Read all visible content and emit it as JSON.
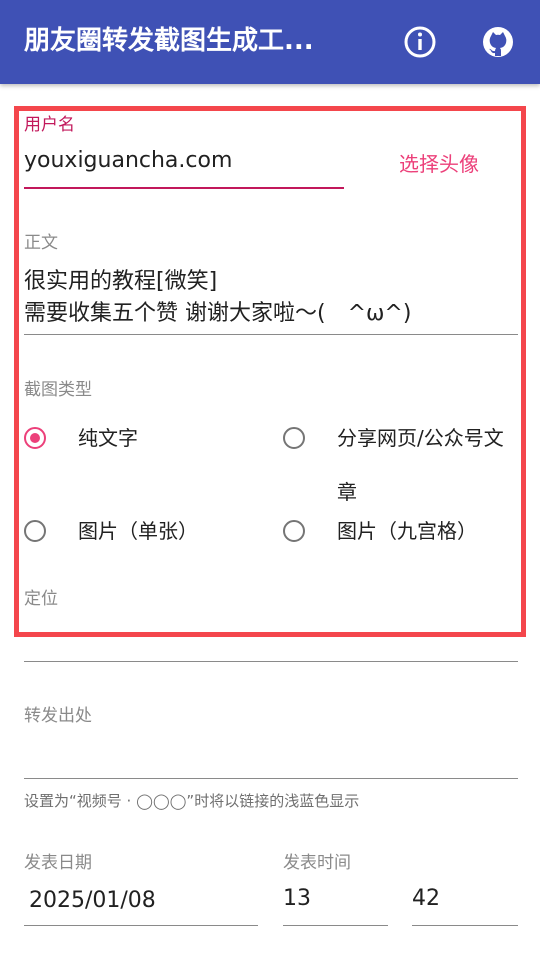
{
  "appbar": {
    "title": "朋友圈转发截图生成工...",
    "info_icon": "info-icon",
    "github_icon": "github-icon"
  },
  "username": {
    "label": "用户名",
    "value": "youxiguancha.com",
    "avatar_button": "选择头像"
  },
  "body_text": {
    "label": "正文",
    "line1": "很实用的教程[微笑]",
    "line2": "需要收集五个赞 谢谢大家啦～(　^ω^)"
  },
  "screenshot_type": {
    "label": "截图类型",
    "options": [
      {
        "label": "纯文字",
        "checked": true
      },
      {
        "label": "分享网页/公众号文章",
        "checked": false
      },
      {
        "label": "图片（单张）",
        "checked": false
      },
      {
        "label": "图片（九宫格）",
        "checked": false
      }
    ]
  },
  "location": {
    "label": "定位",
    "value": ""
  },
  "forward_source": {
    "label": "转发出处",
    "value": "",
    "hint": "设置为“视频号 · ◯◯◯”时将以链接的浅蓝色显示"
  },
  "publish_date": {
    "label": "发表日期",
    "value": "2025/01/08"
  },
  "publish_time": {
    "label": "发表时间",
    "hour": "13",
    "minute": "42"
  },
  "colors": {
    "appbar": "#3f51b5",
    "accent": "#ec407a",
    "focus_underline": "#c2185b",
    "highlight_box": "#f4464c"
  }
}
